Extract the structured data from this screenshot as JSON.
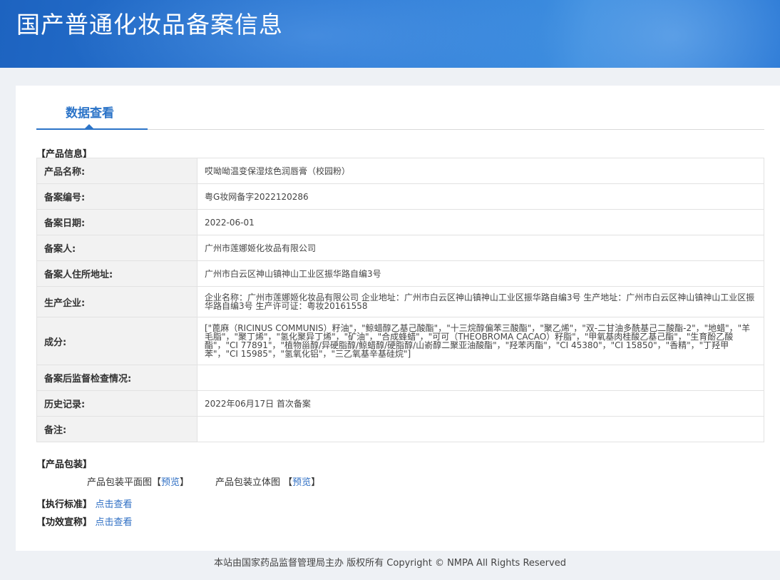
{
  "header": {
    "title": "国产普通化妆品备案信息"
  },
  "tab": {
    "label": "数据查看"
  },
  "product_info": {
    "section_title": "【产品信息】",
    "rows": [
      {
        "label": "产品名称:",
        "value": "哎呦呦温变保湿炫色润唇膏（校园粉）"
      },
      {
        "label": "备案编号:",
        "value": "粤G妆网备字2022120286"
      },
      {
        "label": "备案日期:",
        "value": "2022-06-01"
      },
      {
        "label": "备案人:",
        "value": "广州市莲娜姬化妆品有限公司"
      },
      {
        "label": "备案人住所地址:",
        "value": "广州市白云区神山镇神山工业区振华路自编3号"
      },
      {
        "label": "生产企业:",
        "value": "企业名称：广州市莲娜姬化妆品有限公司 企业地址：广州市白云区神山镇神山工业区振华路自编3号 生产地址：广州市白云区神山镇神山工业区振华路自编3号 生产许可证：粤妆20161558"
      },
      {
        "label": "成分:",
        "value": "[\"蓖麻（RICINUS COMMUNIS）籽油\"，\"鲸蜡醇乙基己酸酯\"，\"十三烷醇偏苯三酸酯\"，\"聚乙烯\"，\"双-二甘油多酰基己二酸酯-2\"，\"地蜡\"，\"羊毛脂\"，\"聚丁烯\"，\"氢化聚异丁烯\"，\"矿油\"，\"合成蜂蜡\"，\"可可（THEOBROMA CACAO）籽脂\"，\"甲氧基肉桂酸乙基己酯\"，\"生育酚乙酸酯\"，\"CI 77891\"，\"植物甾醇/异硬脂醇/鲸蜡醇/硬脂醇/山嵛醇二聚亚油酸酯\"，\"羟苯丙酯\"，\"CI 45380\"，\"CI 15850\"，\"香精\"，\"丁羟甲苯\"，\"CI 15985\"，\"氢氧化铝\"，\"三乙氧基辛基硅烷\"]"
      },
      {
        "label": "备案后监督检查情况:",
        "value": ""
      },
      {
        "label": "历史记录:",
        "value": "2022年06月17日 首次备案"
      },
      {
        "label": "备注:",
        "value": ""
      }
    ]
  },
  "packaging": {
    "section_title": "【产品包装】",
    "flat_label": "产品包装平面图",
    "solid_label": "产品包装立体图",
    "bracket_open": "【",
    "bracket_close": "】",
    "preview_link": "预览"
  },
  "standard": {
    "label": "【执行标准】",
    "link": "点击查看"
  },
  "efficacy": {
    "label": "【功效宣称】",
    "link": "点击查看"
  },
  "footer": {
    "text": "本站由国家药品监督管理局主办 版权所有 Copyright © NMPA All Rights Reserved"
  }
}
